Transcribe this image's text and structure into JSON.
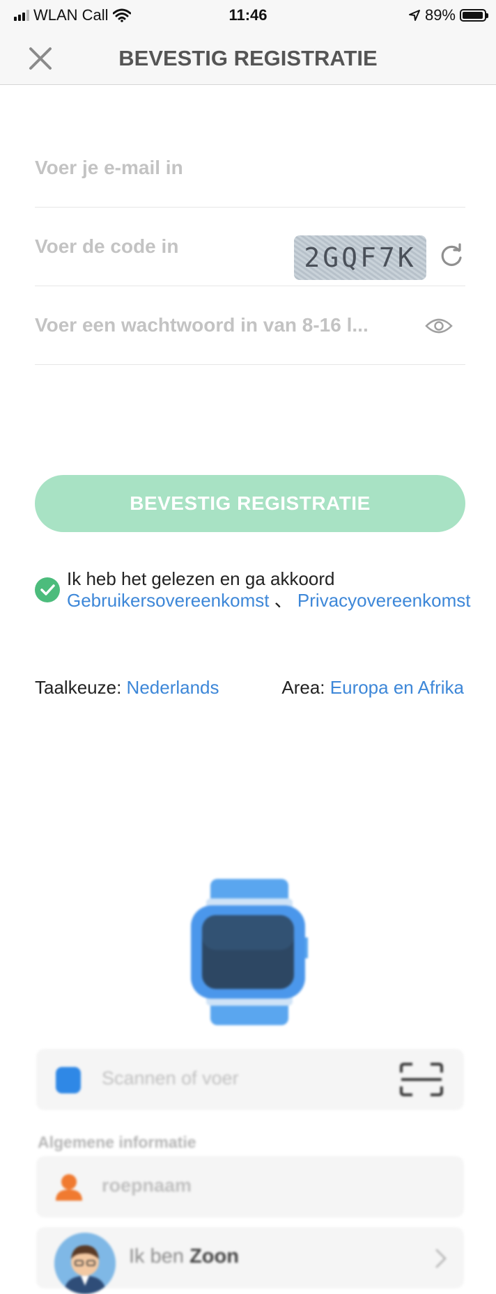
{
  "status_bar": {
    "carrier": "WLAN Call",
    "time": "11:46",
    "battery": "89%",
    "battery_level": 0.89
  },
  "nav": {
    "title": "BEVESTIG REGISTRATIE",
    "close_icon": "close-icon"
  },
  "form": {
    "email_placeholder": "Voer je e-mail in",
    "code_placeholder": "Voer de code in",
    "captcha_text": "2GQF7K",
    "password_placeholder": "Voer een wachtwoord in van 8-16 l..."
  },
  "submit_label": "BEVESTIG REGISTRATIE",
  "agreement": {
    "prefix": "Ik heb het gelezen en ga akkoord ",
    "terms_link": "Gebruikersovereenkomst",
    "separator": " 、 ",
    "privacy_link": "Privacyovereenkomst"
  },
  "language": {
    "label": "Taalkeuze:",
    "value": "Nederlands"
  },
  "area": {
    "label": "Area:",
    "value": "Europa en Afrika"
  },
  "background": {
    "scan_placeholder": "Scannen of voer",
    "section_label": "Algemene informatie",
    "nickname_placeholder": "roepnaam",
    "role_prefix": "Ik ben ",
    "role_value": "Zoon"
  },
  "colors": {
    "primary_button": "#a8e2c4",
    "link": "#3d87d8",
    "check": "#4cbc7c"
  }
}
